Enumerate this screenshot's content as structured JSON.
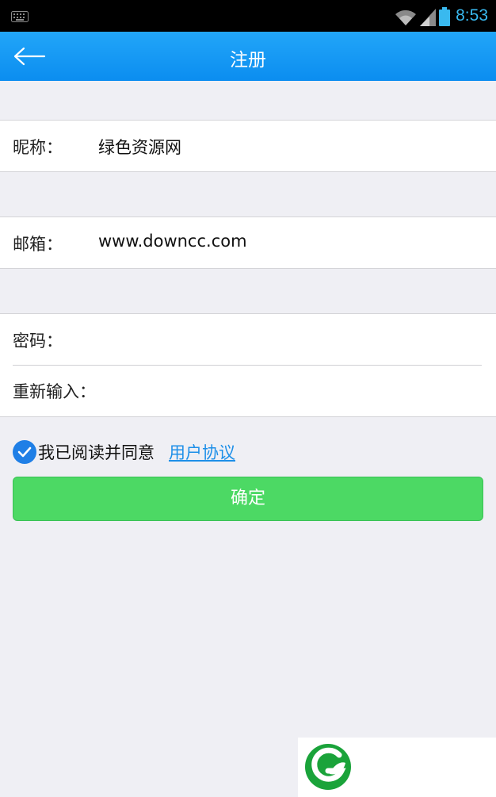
{
  "status_bar": {
    "time": "8:53",
    "icons": [
      "keyboard-icon",
      "wifi-icon",
      "signal-icon",
      "battery-icon"
    ],
    "accent_color": "#39b9ef"
  },
  "app_bar": {
    "title": "注册",
    "back_icon": "back-arrow-icon",
    "color": "#1a9bf5"
  },
  "form": {
    "nickname": {
      "label": "昵称：",
      "value": "绿色资源网"
    },
    "email": {
      "label": "邮箱：",
      "value": "www.downcc.com"
    },
    "password": {
      "label": "密码：",
      "value": ""
    },
    "password_confirm": {
      "label": "重新输入：",
      "value": ""
    }
  },
  "agreement": {
    "checked": true,
    "text": "我已阅读并同意",
    "link": "用户协议",
    "link_color": "#1d8fe8"
  },
  "confirm_button": {
    "label": "确定",
    "color": "#4cd964"
  },
  "watermark": {
    "icon": "leaf-logo-icon"
  }
}
